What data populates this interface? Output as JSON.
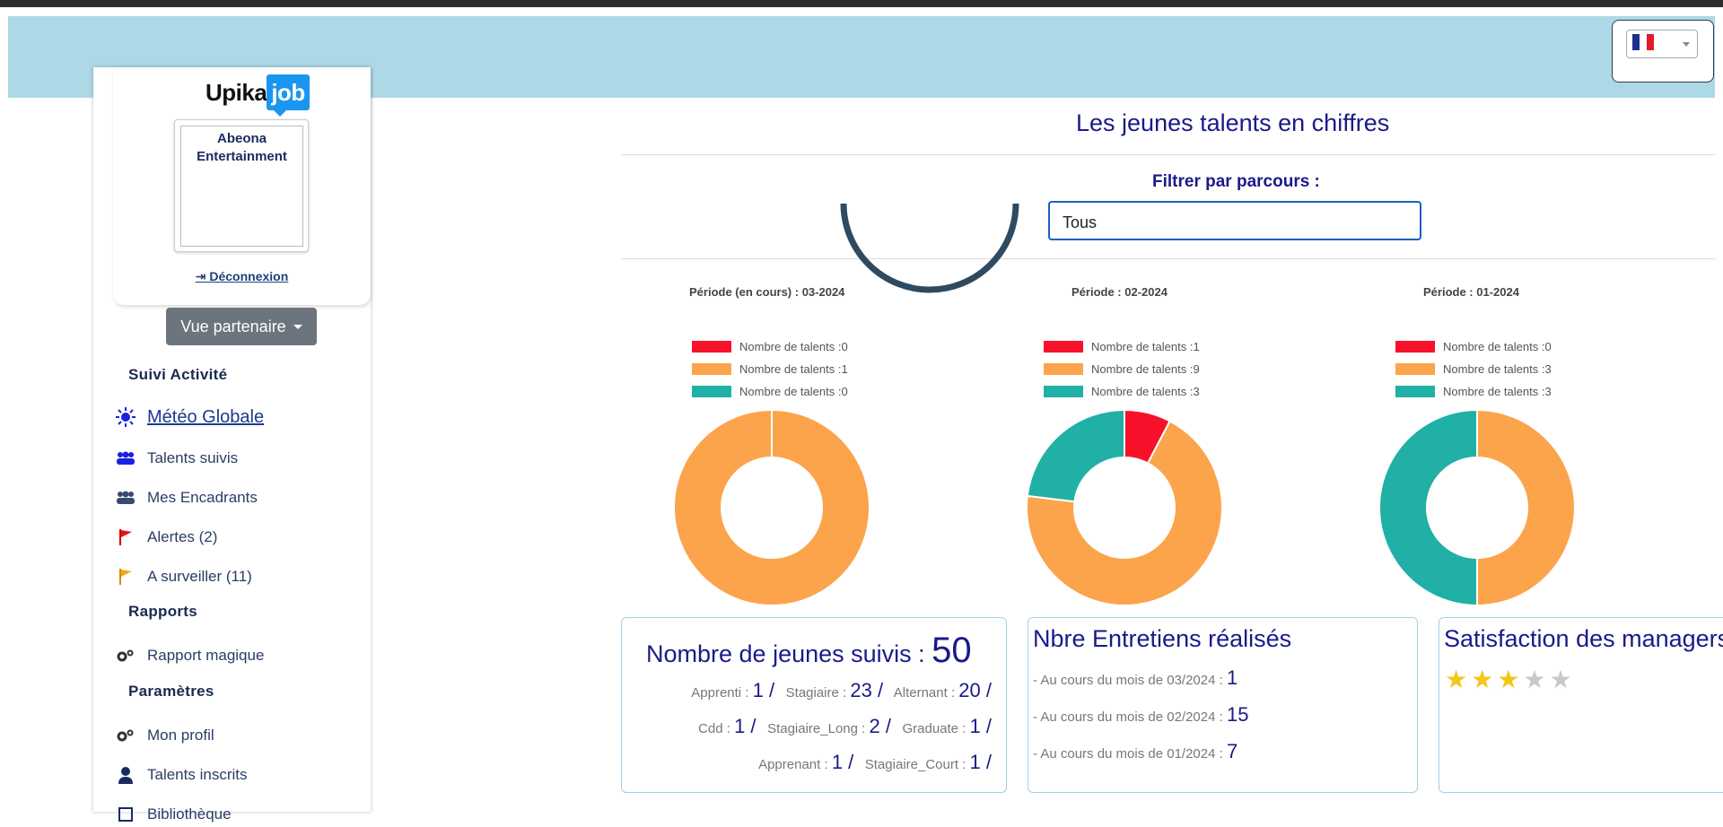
{
  "header": {
    "language_flag": "fr-flag-icon"
  },
  "sidebar": {
    "brand_part1": "Upika",
    "brand_part2": "job",
    "company_name": "Abeona Entertainment",
    "logout_label": "Déconnexion",
    "vue_button": "Vue partenaire",
    "sections": {
      "activite": "Suivi Activité",
      "rapports": "Rapports",
      "parametres": "Paramètres"
    },
    "items": [
      {
        "label": "Météo Globale",
        "icon": "sun-icon"
      },
      {
        "label": "Talents suivis",
        "icon": "users-icon"
      },
      {
        "label": "Mes Encadrants",
        "icon": "users-icon"
      },
      {
        "label": "Alertes (2)",
        "icon": "red-flag-icon"
      },
      {
        "label": "A surveiller (11)",
        "icon": "orange-flag-icon"
      },
      {
        "label": "Rapport magique",
        "icon": "gears-icon"
      },
      {
        "label": "Mon profil",
        "icon": "gears-icon"
      },
      {
        "label": "Talents inscrits",
        "icon": "user-icon"
      },
      {
        "label": "Bibliothèque",
        "icon": "book-icon"
      }
    ]
  },
  "main": {
    "title": "Les jeunes talents en chiffres",
    "filter_label": "Filtrer par parcours :",
    "filter_value": "Tous"
  },
  "colors": {
    "red": "#f8112a",
    "orange": "#fba44b",
    "teal": "#20b0a5"
  },
  "chart_data": [
    {
      "type": "pie",
      "title": "Période (en cours) : 03-2024",
      "categories": [
        "Nombre de talents :0",
        "Nombre de talents :1",
        "Nombre de talents :0"
      ],
      "values": [
        0,
        1,
        0
      ]
    },
    {
      "type": "pie",
      "title": "Période  : 02-2024",
      "categories": [
        "Nombre de talents :1",
        "Nombre de talents :9",
        "Nombre de talents :3"
      ],
      "values": [
        1,
        9,
        3
      ]
    },
    {
      "type": "pie",
      "title": "Période  : 01-2024",
      "categories": [
        "Nombre de talents :0",
        "Nombre de talents :3",
        "Nombre de talents :3"
      ],
      "values": [
        0,
        3,
        3
      ]
    }
  ],
  "cards": {
    "jeunes": {
      "title": "Nombre de jeunes suivis :",
      "total": "50",
      "rows": [
        [
          {
            "k": "Apprenti :",
            "v": "1 /"
          },
          {
            "k": "Stagiaire :",
            "v": "23 /"
          },
          {
            "k": "Alternant :",
            "v": "20 /"
          }
        ],
        [
          {
            "k": "Cdd :",
            "v": "1 /"
          },
          {
            "k": "Stagiaire_Long :",
            "v": "2 /"
          },
          {
            "k": "Graduate :",
            "v": "1 /"
          }
        ],
        [
          {
            "k": "Apprenant :",
            "v": "1 /"
          },
          {
            "k": "Stagiaire_Court :",
            "v": "1 /"
          }
        ]
      ]
    },
    "entretiens": {
      "title": "Nbre Entretiens réalisés",
      "rows": [
        {
          "k": "- Au cours du mois de 03/2024 :",
          "v": "1"
        },
        {
          "k": "- Au cours du mois de 02/2024 :",
          "v": "15"
        },
        {
          "k": "- Au cours du mois de 01/2024 :",
          "v": "7"
        }
      ]
    },
    "satisfaction": {
      "title": "Satisfaction des managers",
      "rating": 3,
      "max": 5
    }
  }
}
